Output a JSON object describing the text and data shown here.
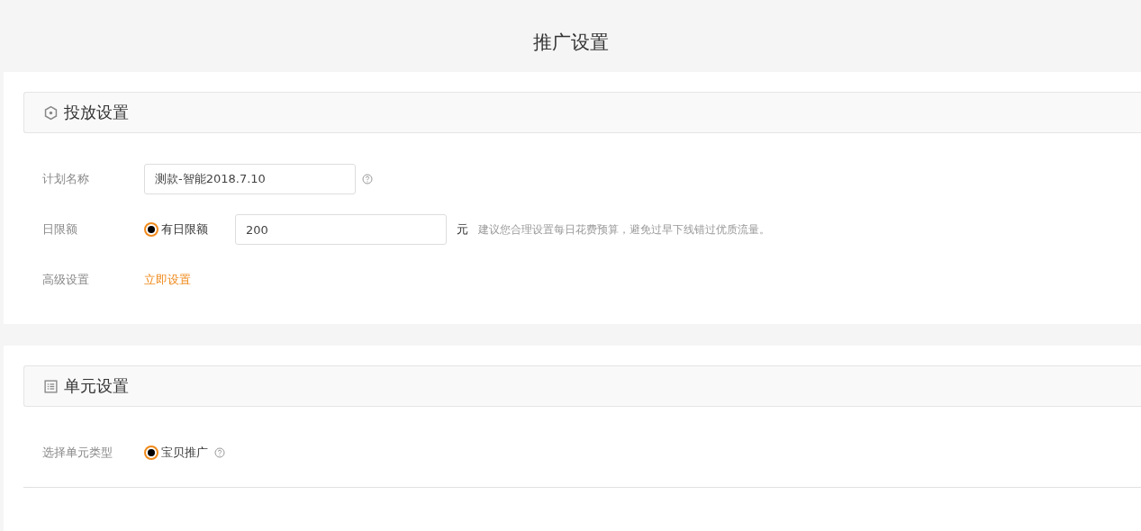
{
  "page_title": "推广设置",
  "sections": [
    {
      "title": "投放设置",
      "rows": [
        {
          "kind": "text",
          "label": "计划名称",
          "value": "测款-智能2018.7.10",
          "help": true
        },
        {
          "kind": "budget",
          "label": "日限额",
          "options": [
            {
              "label": "有日限额",
              "selected": true
            }
          ],
          "value": "200",
          "unit": "元",
          "hint": "建议您合理设置每日花费预算，避免过早下线错过优质流量。"
        },
        {
          "kind": "link",
          "label": "高级设置",
          "link": "立即设置"
        }
      ]
    },
    {
      "title": "单元设置",
      "rows": [
        {
          "kind": "radio",
          "label": "选择单元类型",
          "options": [
            {
              "label": "宝贝推广",
              "selected": true
            }
          ],
          "help": true
        }
      ]
    }
  ]
}
